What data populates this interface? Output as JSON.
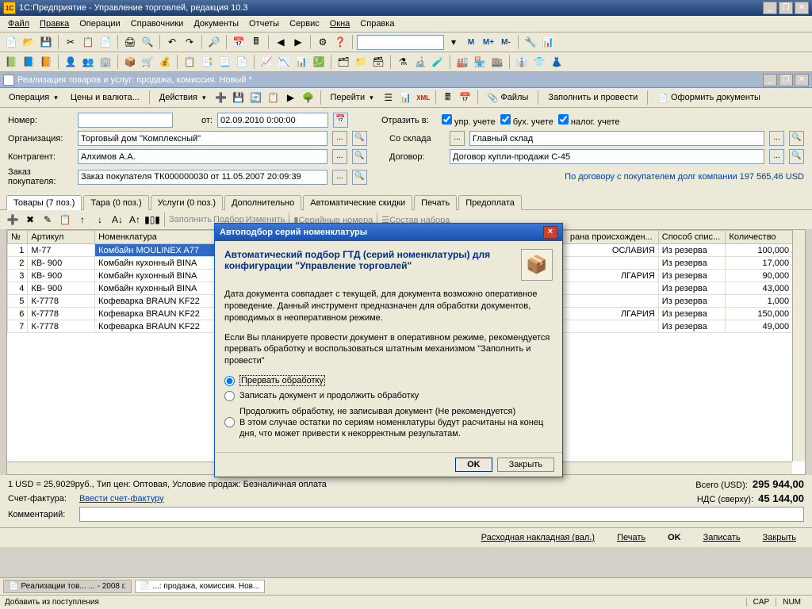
{
  "app": {
    "title": "1С:Предприятие - Управление торговлей, редакция 10.3"
  },
  "menu": [
    "Файл",
    "Правка",
    "Операции",
    "Справочники",
    "Документы",
    "Отчеты",
    "Сервис",
    "Окна",
    "Справка"
  ],
  "calc_labels": {
    "m": "M",
    "mp": "M+",
    "mm": "M-"
  },
  "doc": {
    "title": "Реализация товаров и услуг: продажа, комиссия. Новый *"
  },
  "doctb": {
    "operation": "Операция",
    "prices": "Цены и валюта...",
    "actions": "Действия",
    "go": "Перейти",
    "files": "Файлы",
    "fill_post": "Заполнить и провести",
    "issue": "Оформить документы"
  },
  "form": {
    "number_lbl": "Номер:",
    "number": "",
    "from_lbl": "от:",
    "date": "02.09.2010 0:00:00",
    "reflect_lbl": "Отразить в:",
    "chk_upr": "упр. учете",
    "chk_buh": "бух. учете",
    "chk_nal": "налог. учете",
    "org_lbl": "Организация:",
    "org": "Торговый дом \"Комплексный\"",
    "wh_lbl": "Со склада",
    "wh": "Главный склад",
    "contr_lbl": "Контрагент:",
    "contr": "Алхимов А.А.",
    "dog_lbl": "Договор:",
    "dog": "Договор купли-продажи С-45",
    "order_lbl": "Заказ покупателя:",
    "order": "Заказ покупателя ТК000000030 от 11.05.2007 20:09:39",
    "debt": "По договору с покупателем долг компании 197 565,46 USD"
  },
  "tabs": [
    "Товары (7 поз.)",
    "Тара (0 поз.)",
    "Услуги (0 поз.)",
    "Дополнительно",
    "Автоматические скидки",
    "Печать",
    "Предоплата"
  ],
  "subtb": {
    "fill": "Заполнить",
    "pick": "Подбор",
    "change": "Изменить",
    "serials": "Серийные номера",
    "kit": "Состав набора"
  },
  "grid": {
    "cols": [
      "№",
      "Артикул",
      "Номенклатура",
      "рана происхожден...",
      "Способ спис...",
      "Количество"
    ],
    "rows": [
      {
        "n": "1",
        "art": "М-77",
        "nom": "Комбайн MOULINEX A77",
        "country": "ОСЛАВИЯ",
        "method": "Из резерва",
        "qty": "100,000"
      },
      {
        "n": "2",
        "art": "КВ- 900",
        "nom": "Комбайн кухонный BINA",
        "country": "",
        "method": "Из резерва",
        "qty": "17,000"
      },
      {
        "n": "3",
        "art": "КВ- 900",
        "nom": "Комбайн кухонный BINA",
        "country": "ЛГАРИЯ",
        "method": "Из резерва",
        "qty": "90,000"
      },
      {
        "n": "4",
        "art": "КВ- 900",
        "nom": "Комбайн кухонный BINA",
        "country": "",
        "method": "Из резерва",
        "qty": "43,000"
      },
      {
        "n": "5",
        "art": "К-7778",
        "nom": "Кофеварка BRAUN KF22",
        "country": "",
        "method": "Из резерва",
        "qty": "1,000"
      },
      {
        "n": "6",
        "art": "К-7778",
        "nom": "Кофеварка BRAUN KF22",
        "country": "ЛГАРИЯ",
        "method": "Из резерва",
        "qty": "150,000"
      },
      {
        "n": "7",
        "art": "К-7778",
        "nom": "Кофеварка BRAUN KF22",
        "country": "",
        "method": "Из резерва",
        "qty": "49,000"
      }
    ]
  },
  "footer": {
    "rate": "1 USD = 25,9029руб., Тип цен: Оптовая, Условие продаж: Безналичная оплата",
    "total_lbl": "Всего (USD):",
    "total": "295 944,00",
    "sf_lbl": "Счет-фактура:",
    "sf_link": "Ввести счет-фактуру",
    "nds_lbl": "НДС (сверху):",
    "nds": "45 144,00",
    "comment_lbl": "Комментарий:",
    "comment": ""
  },
  "actions": {
    "rn": "Расходная накладная (вал.)",
    "print": "Печать",
    "ok": "OK",
    "save": "Записать",
    "close": "Закрыть"
  },
  "taskbar": {
    "t1": "Реализации тов... ... - 2008 г.",
    "t2": "...: продажа, комиссия. Нов..."
  },
  "status": {
    "hint": "Добавить из поступления",
    "cap": "CAP",
    "num": "NUM"
  },
  "modal": {
    "title": "Автоподбор серий номенклатуры",
    "head": "Автоматический подбор ГТД (серий номенклатуры) для конфигурации \"Управление торговлей\"",
    "p1": "Дата документа совпадает с текущей, для документа возможно оперативное проведение. Данный инструмент предназначен для обработки документов, проводимых в неоперативном режиме.",
    "p2": "Если Вы планируете провести документ в оперативном режиме, рекомендуется прервать обработку и воспользоваться штатным механизмом \"Заполнить и провести\"",
    "r1": "Прервать обработку",
    "r2": "Записать документ и продолжить обработку",
    "r3a": "Продолжить обработку, не записывая документ (Не рекомендуется)",
    "r3b": "В этом случае остатки по сериям номенклатуры будут расчитаны на конец дня, что может привести к некорректным результатам.",
    "ok": "OK",
    "close": "Закрыть"
  }
}
